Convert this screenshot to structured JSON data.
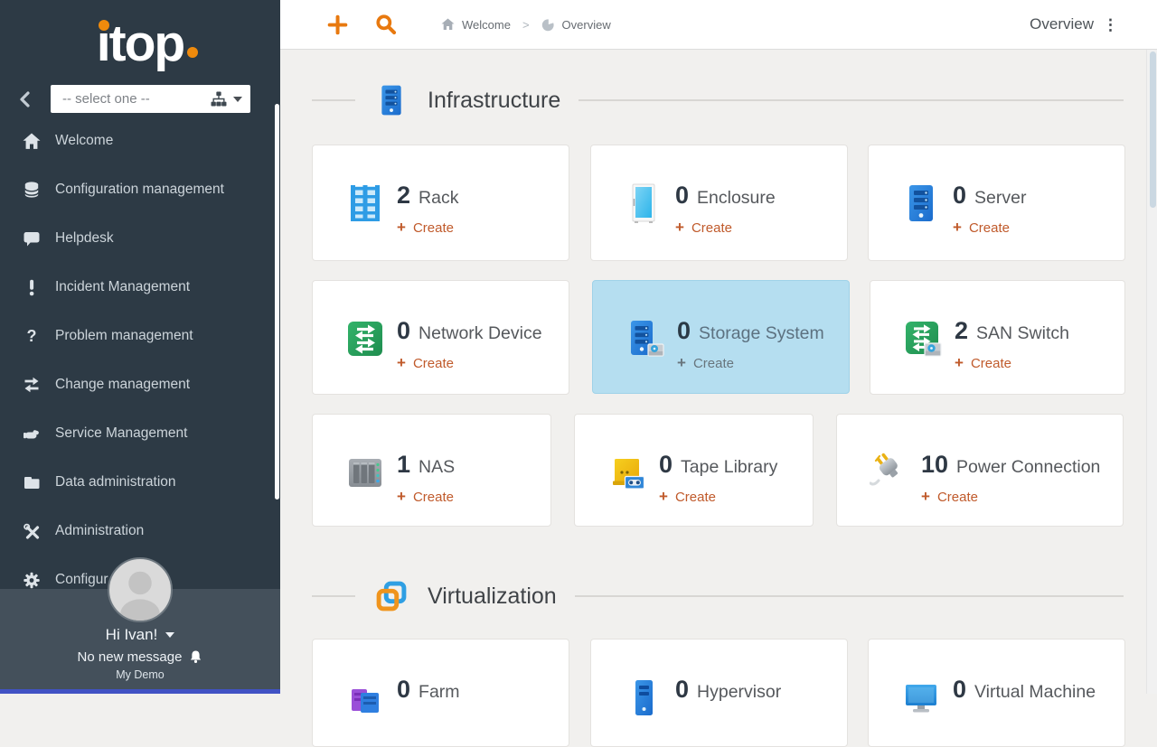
{
  "glyphs": {
    "plus": "+",
    "kebab": "⋮",
    "breadcrumb_sep": ">",
    "question": "?"
  },
  "logo": {
    "text": "ıtop"
  },
  "sidebar": {
    "org_select": {
      "placeholder": "-- select one --"
    },
    "items": [
      {
        "label": "Welcome",
        "icon": "home-icon"
      },
      {
        "label": "Configuration management",
        "icon": "database-icon"
      },
      {
        "label": "Helpdesk",
        "icon": "comment-icon"
      },
      {
        "label": "Incident Management",
        "icon": "exclamation-icon"
      },
      {
        "label": "Problem management",
        "icon": "question-icon"
      },
      {
        "label": "Change management",
        "icon": "exchange-icon"
      },
      {
        "label": "Service Management",
        "icon": "handshake-icon"
      },
      {
        "label": "Data administration",
        "icon": "folder-icon"
      },
      {
        "label": "Administration",
        "icon": "tools-icon"
      },
      {
        "label": "Configur",
        "icon": "gear-icon"
      }
    ],
    "user": {
      "greeting": "Hi Ivan!",
      "notifications": "No new message",
      "env": "My Demo"
    }
  },
  "topbar": {
    "breadcrumb": {
      "home": "Welcome",
      "current": "Overview"
    },
    "menu_label": "Overview"
  },
  "sections": [
    {
      "title": "Infrastructure",
      "icon": "server-icon",
      "cards": [
        {
          "count": "2",
          "label": "Rack",
          "create_label": "Create",
          "icon": "rack-icon"
        },
        {
          "count": "0",
          "label": "Enclosure",
          "create_label": "Create",
          "icon": "enclosure-icon"
        },
        {
          "count": "0",
          "label": "Server",
          "create_label": "Create",
          "icon": "server-icon"
        },
        {
          "count": "0",
          "label": "Network Device",
          "create_label": "Create",
          "icon": "network-switch-icon"
        },
        {
          "count": "0",
          "label": "Storage System",
          "create_label": "Create",
          "icon": "storage-system-icon",
          "highlighted": true
        },
        {
          "count": "2",
          "label": "SAN Switch",
          "create_label": "Create",
          "icon": "san-switch-icon"
        },
        {
          "count": "1",
          "label": "NAS",
          "create_label": "Create",
          "icon": "nas-icon"
        },
        {
          "count": "0",
          "label": "Tape Library",
          "create_label": "Create",
          "icon": "tape-library-icon"
        },
        {
          "count": "10",
          "label": "Power Connection",
          "create_label": "Create",
          "icon": "power-plug-icon"
        }
      ]
    },
    {
      "title": "Virtualization",
      "icon": "virtualization-icon",
      "cards": [
        {
          "count": "0",
          "label": "Farm",
          "icon": "farm-icon"
        },
        {
          "count": "0",
          "label": "Hypervisor",
          "icon": "hypervisor-icon"
        },
        {
          "count": "0",
          "label": "Virtual Machine",
          "icon": "virtual-machine-icon"
        }
      ]
    }
  ],
  "colors": {
    "accent_orange": "#e8790f",
    "create_link": "#c05a2b",
    "highlight_card_bg": "#b5def0",
    "sidebar_bg": "#2d3a45",
    "sidebar_user_bg": "#44505b"
  }
}
